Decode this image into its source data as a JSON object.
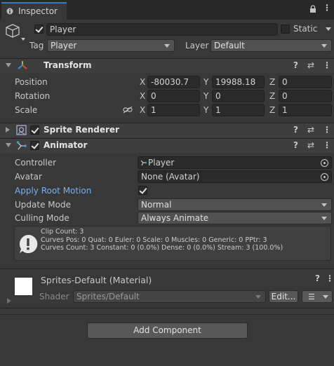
{
  "tab": {
    "title": "Inspector"
  },
  "object": {
    "name": "Player",
    "static_label": "Static",
    "tag_label": "Tag",
    "tag_value": "Player",
    "layer_label": "Layer",
    "layer_value": "Default"
  },
  "transform": {
    "title": "Transform",
    "position_label": "Position",
    "rotation_label": "Rotation",
    "scale_label": "Scale",
    "position": {
      "x": "-80030.7",
      "y": "19988.18",
      "z": "0"
    },
    "rotation": {
      "x": "0",
      "y": "0",
      "z": "0"
    },
    "scale": {
      "x": "1",
      "y": "1",
      "z": "1"
    },
    "axis_x": "X",
    "axis_y": "Y",
    "axis_z": "Z"
  },
  "sprite_renderer": {
    "title": "Sprite Renderer"
  },
  "animator": {
    "title": "Animator",
    "controller_label": "Controller",
    "controller_value": "Player",
    "avatar_label": "Avatar",
    "avatar_value": "None (Avatar)",
    "apply_root_motion_label": "Apply Root Motion",
    "update_mode_label": "Update Mode",
    "update_mode_value": "Normal",
    "culling_mode_label": "Culling Mode",
    "culling_mode_value": "Always Animate",
    "info_line1": "Clip Count: 3",
    "info_line2": "Curves Pos: 0 Quat: 0 Euler: 0 Scale: 0 Muscles: 0 Generic: 0 PPtr: 3",
    "info_line3": "Curves Count: 3 Constant: 0 (0.0%) Dense: 0 (0.0%) Stream: 3 (100.0%)"
  },
  "material": {
    "title": "Sprites-Default (Material)",
    "shader_label": "Shader",
    "shader_value": "Sprites/Default",
    "edit_label": "Edit..."
  },
  "add_component_label": "Add Component",
  "header_icons": {
    "help": "?",
    "settings": "⇄",
    "more": "⋮"
  }
}
